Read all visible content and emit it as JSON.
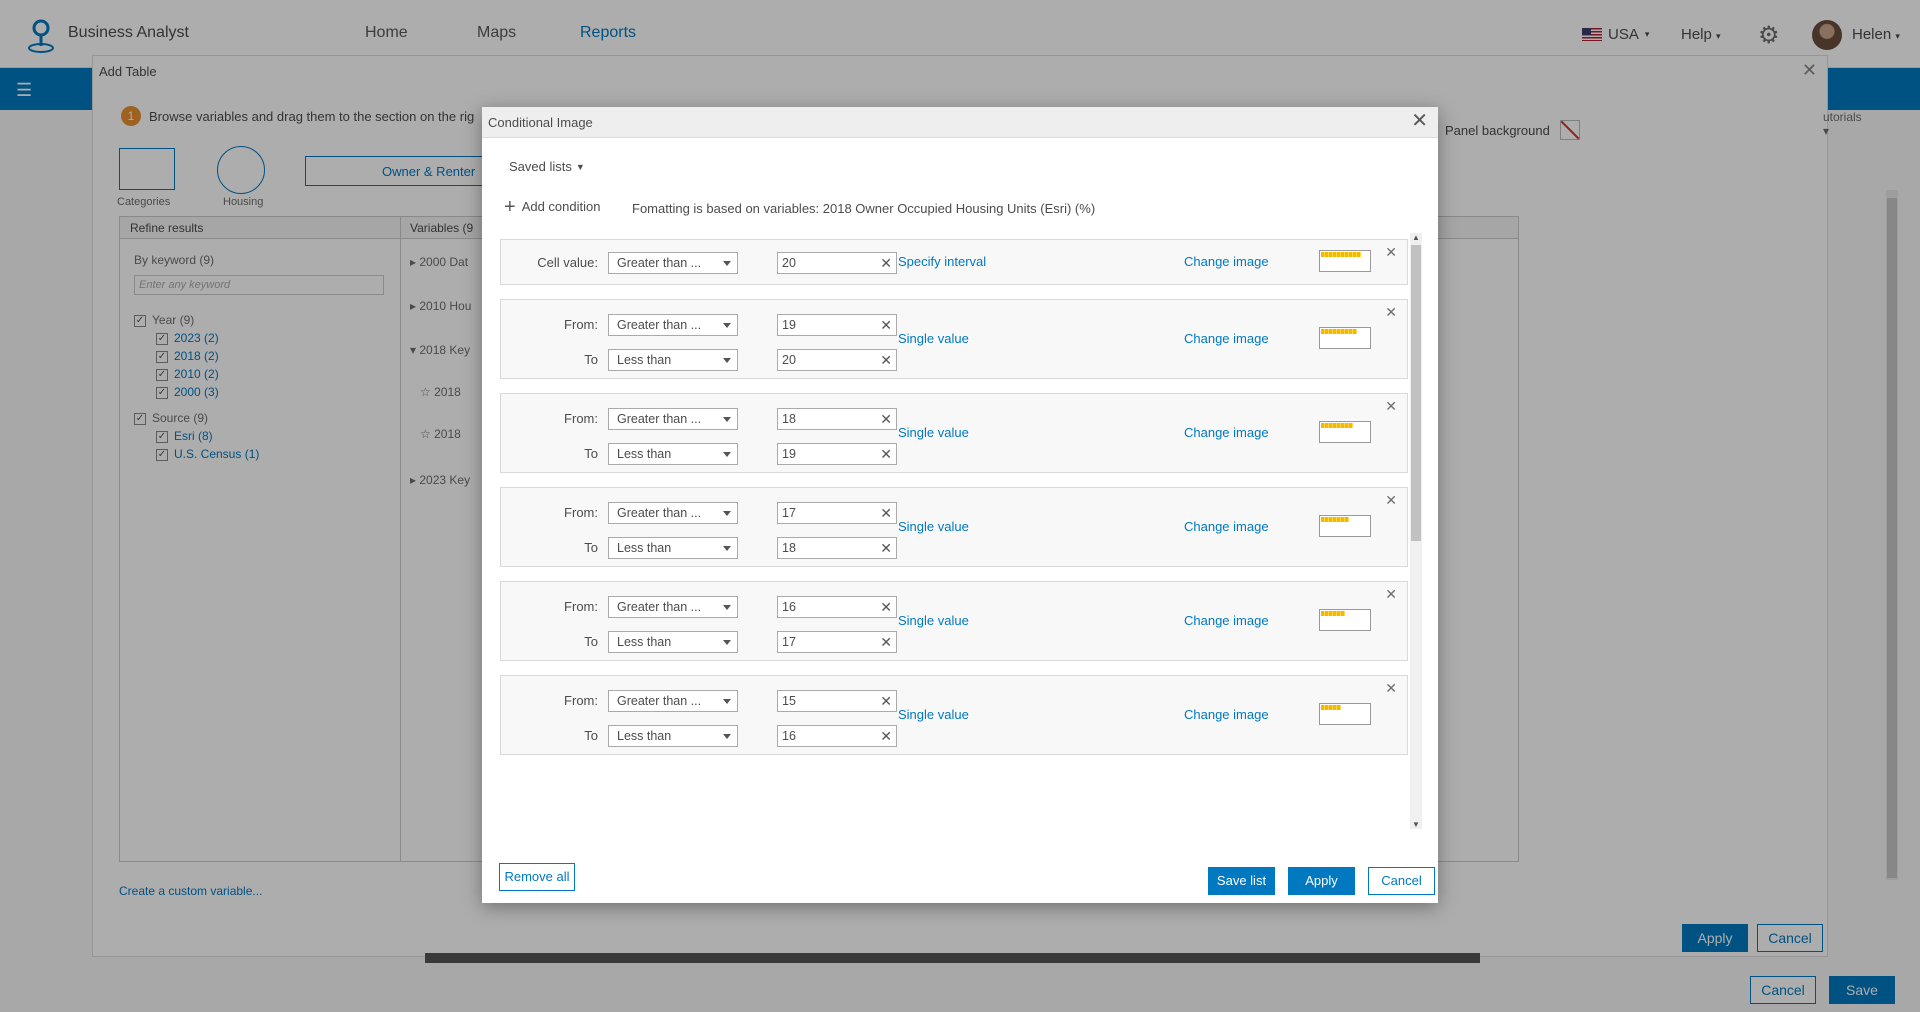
{
  "app": {
    "name": "Business Analyst",
    "nav": [
      "Home",
      "Maps",
      "Reports"
    ],
    "country": "USA",
    "help": "Help",
    "user": "Helen"
  },
  "add_table": {
    "title": "Add Table",
    "step1": "Browse variables and drag them to the section on the rig",
    "step_num": "1",
    "crumb_categories": "Categories",
    "crumb_housing": "Housing",
    "owner_box": "Owner & Renter",
    "refine_head": "Refine results",
    "variables_head": "Variables (9",
    "by_keyword": "By keyword (9)",
    "keyword_placeholder": "Enter any keyword",
    "year": "Year (9)",
    "years": [
      "2023 (2)",
      "2018 (2)",
      "2010 (2)",
      "2000 (3)"
    ],
    "source": "Source (9)",
    "sources": [
      "Esri (8)",
      "U.S. Census (1)"
    ],
    "var_groups": [
      "2000 Dat",
      "2010 Hou",
      "2018 Key",
      "2018",
      "2018",
      "2023 Key"
    ],
    "custom_variable": "Create a custom variable...",
    "apply": "Apply",
    "cancel": "Cancel",
    "panel_background": "Panel background",
    "tutorials": "utorials"
  },
  "page_buttons": {
    "cancel": "Cancel",
    "save": "Save"
  },
  "dialog": {
    "title": "Conditional Image",
    "saved_lists": "Saved lists",
    "add_condition": "Add condition",
    "format_note": "Fomatting is based on variables: 2018 Owner Occupied Housing Units (Esri) (%)",
    "remove_all": "Remove all",
    "save_list": "Save list",
    "apply": "Apply",
    "cancel": "Cancel",
    "conditions": [
      {
        "label1": "Cell value:",
        "op1": "Greater than ...",
        "val1": "20",
        "mode": "Specify interval",
        "change": "Change image",
        "fill": 0.8
      },
      {
        "label1": "From:",
        "op1": "Greater than ...",
        "val1": "19",
        "label2": "To",
        "op2": "Less than",
        "val2": "20",
        "mode": "Single value",
        "change": "Change image",
        "fill": 0.72
      },
      {
        "label1": "From:",
        "op1": "Greater than ...",
        "val1": "18",
        "label2": "To",
        "op2": "Less than",
        "val2": "19",
        "mode": "Single value",
        "change": "Change image",
        "fill": 0.64
      },
      {
        "label1": "From:",
        "op1": "Greater than ...",
        "val1": "17",
        "label2": "To",
        "op2": "Less than",
        "val2": "18",
        "mode": "Single value",
        "change": "Change image",
        "fill": 0.56
      },
      {
        "label1": "From:",
        "op1": "Greater than ...",
        "val1": "16",
        "label2": "To",
        "op2": "Less than",
        "val2": "17",
        "mode": "Single value",
        "change": "Change image",
        "fill": 0.48
      },
      {
        "label1": "From:",
        "op1": "Greater than ...",
        "val1": "15",
        "label2": "To",
        "op2": "Less than",
        "val2": "16",
        "mode": "Single value",
        "change": "Change image",
        "fill": 0.4
      }
    ]
  }
}
